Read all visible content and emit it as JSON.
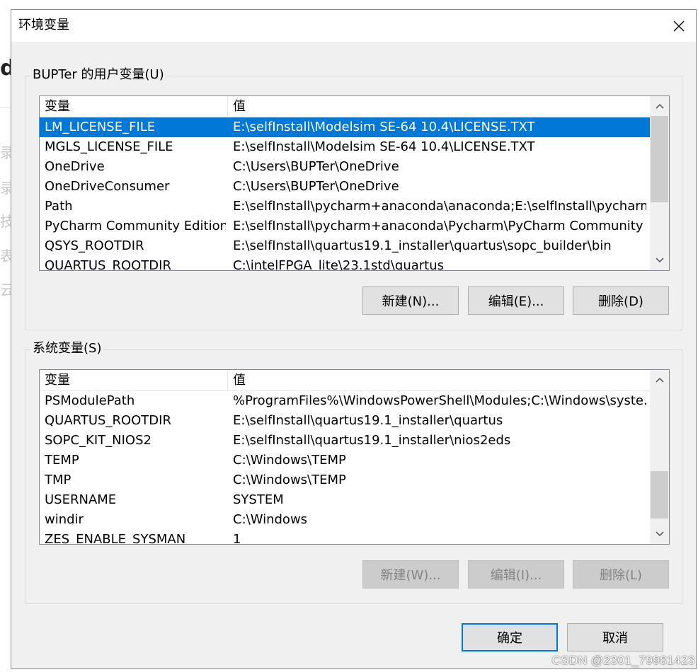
{
  "window": {
    "title": "环境变量"
  },
  "user_vars": {
    "group_label": "BUPTer 的用户变量(U)",
    "columns": [
      "变量",
      "值"
    ],
    "rows": [
      {
        "name": "LM_LICENSE_FILE",
        "value": "E:\\selfInstall\\Modelsim SE-64 10.4\\LICENSE.TXT"
      },
      {
        "name": "MGLS_LICENSE_FILE",
        "value": "E:\\selfInstall\\Modelsim SE-64 10.4\\LICENSE.TXT"
      },
      {
        "name": "OneDrive",
        "value": "C:\\Users\\BUPTer\\OneDrive"
      },
      {
        "name": "OneDriveConsumer",
        "value": "C:\\Users\\BUPTer\\OneDrive"
      },
      {
        "name": "Path",
        "value": "E:\\selfInstall\\pycharm+anaconda\\anaconda;E:\\selfInstall\\pycharm..."
      },
      {
        "name": "PyCharm Community Edition",
        "value": "E:\\selfInstall\\pycharm+anaconda\\Pycharm\\PyCharm Community E..."
      },
      {
        "name": "QSYS_ROOTDIR",
        "value": "E:\\selfInstall\\quartus19.1_installer\\quartus\\sopc_builder\\bin"
      },
      {
        "name": "QUARTUS_ROOTDIR",
        "value": "C:\\intelFPGA_lite\\23.1std\\quartus"
      }
    ],
    "buttons": {
      "new": "新建(N)...",
      "edit": "编辑(E)...",
      "delete": "删除(D)"
    }
  },
  "system_vars": {
    "group_label": "系统变量(S)",
    "columns": [
      "变量",
      "值"
    ],
    "rows": [
      {
        "name": "PSModulePath",
        "value": "%ProgramFiles%\\WindowsPowerShell\\Modules;C:\\Windows\\syste..."
      },
      {
        "name": "QUARTUS_ROOTDIR",
        "value": "E:\\selfInstall\\quartus19.1_installer\\quartus"
      },
      {
        "name": "SOPC_KIT_NIOS2",
        "value": "E:\\selfInstall\\quartus19.1_installer\\nios2eds"
      },
      {
        "name": "TEMP",
        "value": "C:\\Windows\\TEMP"
      },
      {
        "name": "TMP",
        "value": "C:\\Windows\\TEMP"
      },
      {
        "name": "USERNAME",
        "value": "SYSTEM"
      },
      {
        "name": "windir",
        "value": "C:\\Windows"
      },
      {
        "name": "ZES_ENABLE_SYSMAN",
        "value": "1"
      }
    ],
    "buttons": {
      "new": "新建(W)...",
      "edit": "编辑(I)...",
      "delete": "删除(L)"
    }
  },
  "footer": {
    "ok": "确定",
    "cancel": "取消"
  },
  "watermark": "CSDN @2301_79981423",
  "background_fragments": [
    "d",
    "录",
    "录",
    "技",
    "表",
    "云"
  ],
  "colors": {
    "selection": "#0078d7",
    "dialog_bg": "#f0f0f0",
    "button_bg": "#e1e1e1"
  }
}
